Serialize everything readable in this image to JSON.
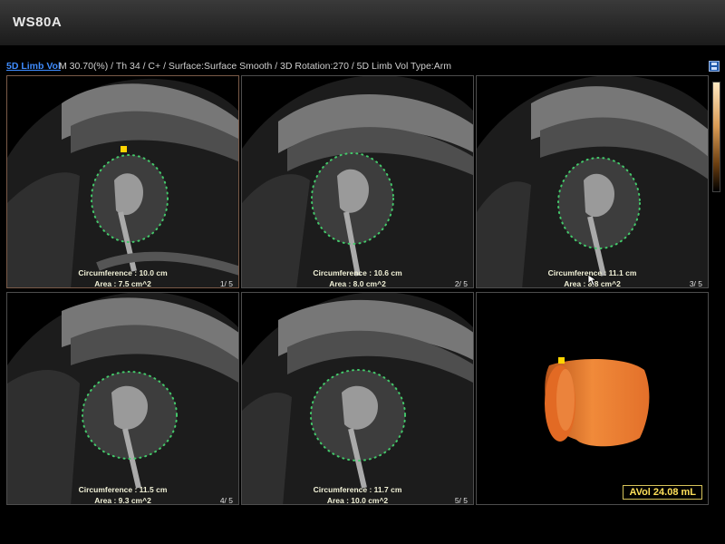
{
  "app": {
    "title": "WS80A"
  },
  "info": {
    "mode": "5D Limb Vol",
    "params": "M 30.70(%) / Th 34 / C+ / Surface:Surface Smooth / 3D Rotation:270 / 5D Limb Vol Type:Arm"
  },
  "icons": {
    "save": "save-icon",
    "marker": "yellow-square-marker",
    "cursor": "arrow-cursor-icon"
  },
  "slices": [
    {
      "circumference": "Circumference : 10.0 cm",
      "area": "Area : 7.5 cm^2",
      "index": "1/ 5"
    },
    {
      "circumference": "Circumference : 10.6 cm",
      "area": "Area : 8.0 cm^2",
      "index": "2/ 5"
    },
    {
      "circumference": "Circumference : 11.1 cm",
      "area": "Area : 8.8 cm^2",
      "index": "3/ 5"
    },
    {
      "circumference": "Circumference : 11.5 cm",
      "area": "Area : 9.3 cm^2",
      "index": "4/ 5"
    },
    {
      "circumference": "Circumference : 11.7 cm",
      "area": "Area : 10.0 cm^2",
      "index": "5/ 5"
    }
  ],
  "volume": {
    "label": "AVol 24.08 mL"
  },
  "colors": {
    "accent": "#3f8cff",
    "trace_dots": "#43c96a",
    "volume_render": "#e8782c",
    "highlight": "#ffd400"
  }
}
